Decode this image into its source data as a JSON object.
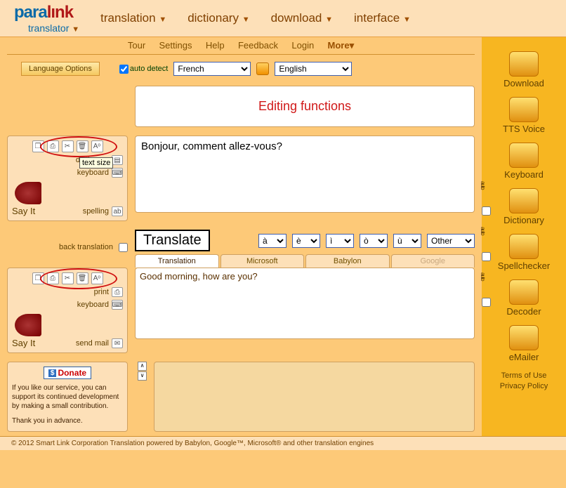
{
  "logo": {
    "part1": "para",
    "part2": "lınk",
    "sub": "translator"
  },
  "mainnav": {
    "translation": "translation",
    "dictionary": "dictionary",
    "download": "download",
    "interface": "interface"
  },
  "topbar": {
    "tour": "Tour",
    "settings": "Settings",
    "help": "Help",
    "feedback": "Feedback",
    "login": "Login",
    "more": "More▾"
  },
  "lang": {
    "options": "Language Options",
    "auto": "auto detect",
    "from": "French",
    "to": "English"
  },
  "banner": "Editing functions",
  "src": {
    "dictionary": "dictionary",
    "keyboard": "keyboard",
    "spelling": "spelling",
    "sayit": "Say It",
    "tooltip": "text size",
    "text": "Bonjour, comment allez-vous?"
  },
  "mid": {
    "back": "back translation",
    "translate": "Translate",
    "acc": [
      "à",
      "è",
      "ì",
      "ò",
      "ù"
    ],
    "other": "Other"
  },
  "tabs": {
    "t1": "Translation",
    "t2": "Microsoft",
    "t3": "Babylon",
    "t4": "Google"
  },
  "dst": {
    "print": "print",
    "keyboard": "keyboard",
    "sendmail": "send mail",
    "sayit": "Say It",
    "text": "Good morning, how are you?"
  },
  "donate": {
    "btn": "Donate",
    "msg": "If you like our service, you can support its continued development by making a small contribution.",
    "thanks": "Thank you in advance."
  },
  "side": {
    "download": "Download",
    "tts": "TTS Voice",
    "keyboard": "Keyboard",
    "dictionary": "Dictionary",
    "spell": "Spellchecker",
    "decoder": "Decoder",
    "emailer": "eMailer",
    "auto": "auto"
  },
  "footer": {
    "terms": "Terms of Use",
    "privacy": "Privacy Policy"
  },
  "bottom": "© 2012 Smart Link Corporation   Translation powered by Babylon, Google™, Microsoft® and other translation engines"
}
